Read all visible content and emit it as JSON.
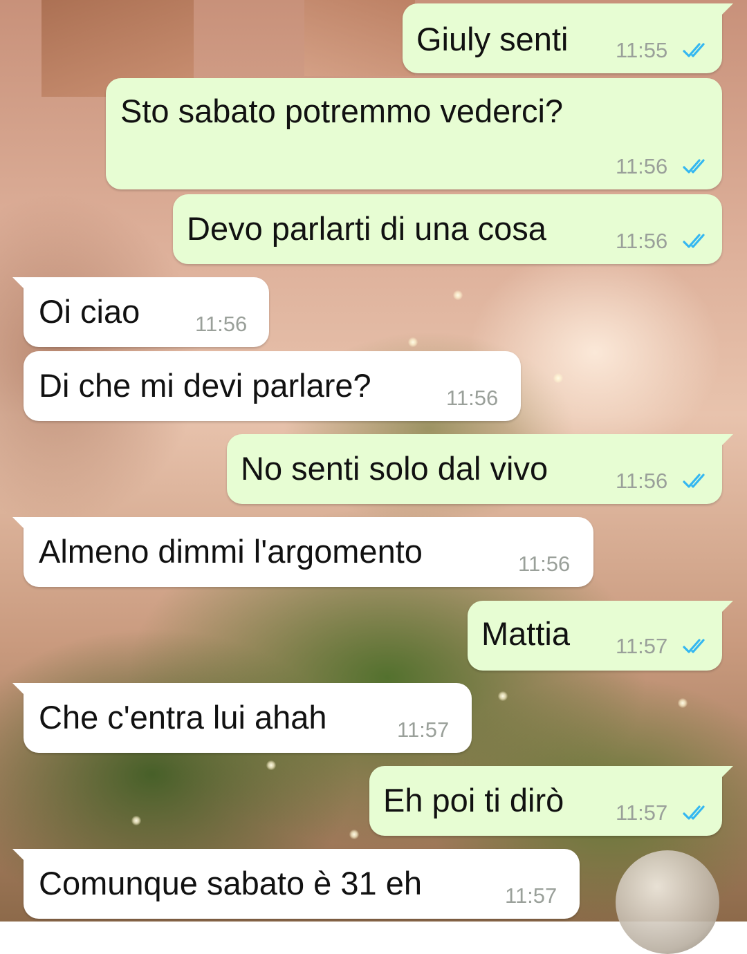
{
  "conversation": {
    "messages": [
      {
        "direction": "outgoing",
        "text": "Giuly senti",
        "time": "11:55",
        "status": "read"
      },
      {
        "direction": "outgoing",
        "text": "Sto sabato potremmo vederci?",
        "time": "11:56",
        "status": "read"
      },
      {
        "direction": "outgoing",
        "text": "Devo parlarti di una cosa",
        "time": "11:56",
        "status": "read"
      },
      {
        "direction": "incoming",
        "text": "Oi ciao",
        "time": "11:56"
      },
      {
        "direction": "incoming",
        "text": "Di che mi devi parlare?",
        "time": "11:56"
      },
      {
        "direction": "outgoing",
        "text": "No senti solo dal vivo",
        "time": "11:56",
        "status": "read"
      },
      {
        "direction": "incoming",
        "text": "Almeno dimmi l'argomento",
        "time": "11:56"
      },
      {
        "direction": "outgoing",
        "text": "Mattia",
        "time": "11:57",
        "status": "read"
      },
      {
        "direction": "incoming",
        "text": "Che c'entra lui ahah",
        "time": "11:57"
      },
      {
        "direction": "outgoing",
        "text": "Eh poi ti dirò",
        "time": "11:57",
        "status": "read"
      },
      {
        "direction": "incoming",
        "text": "Comunque sabato è 31 eh",
        "time": "11:57"
      }
    ]
  },
  "colors": {
    "outgoing_bubble": "#e7fdd3",
    "incoming_bubble": "#ffffff",
    "read_check": "#34b7f1",
    "timestamp": "#9aa09a"
  },
  "icons": {
    "read_receipt": "double-check-icon"
  }
}
